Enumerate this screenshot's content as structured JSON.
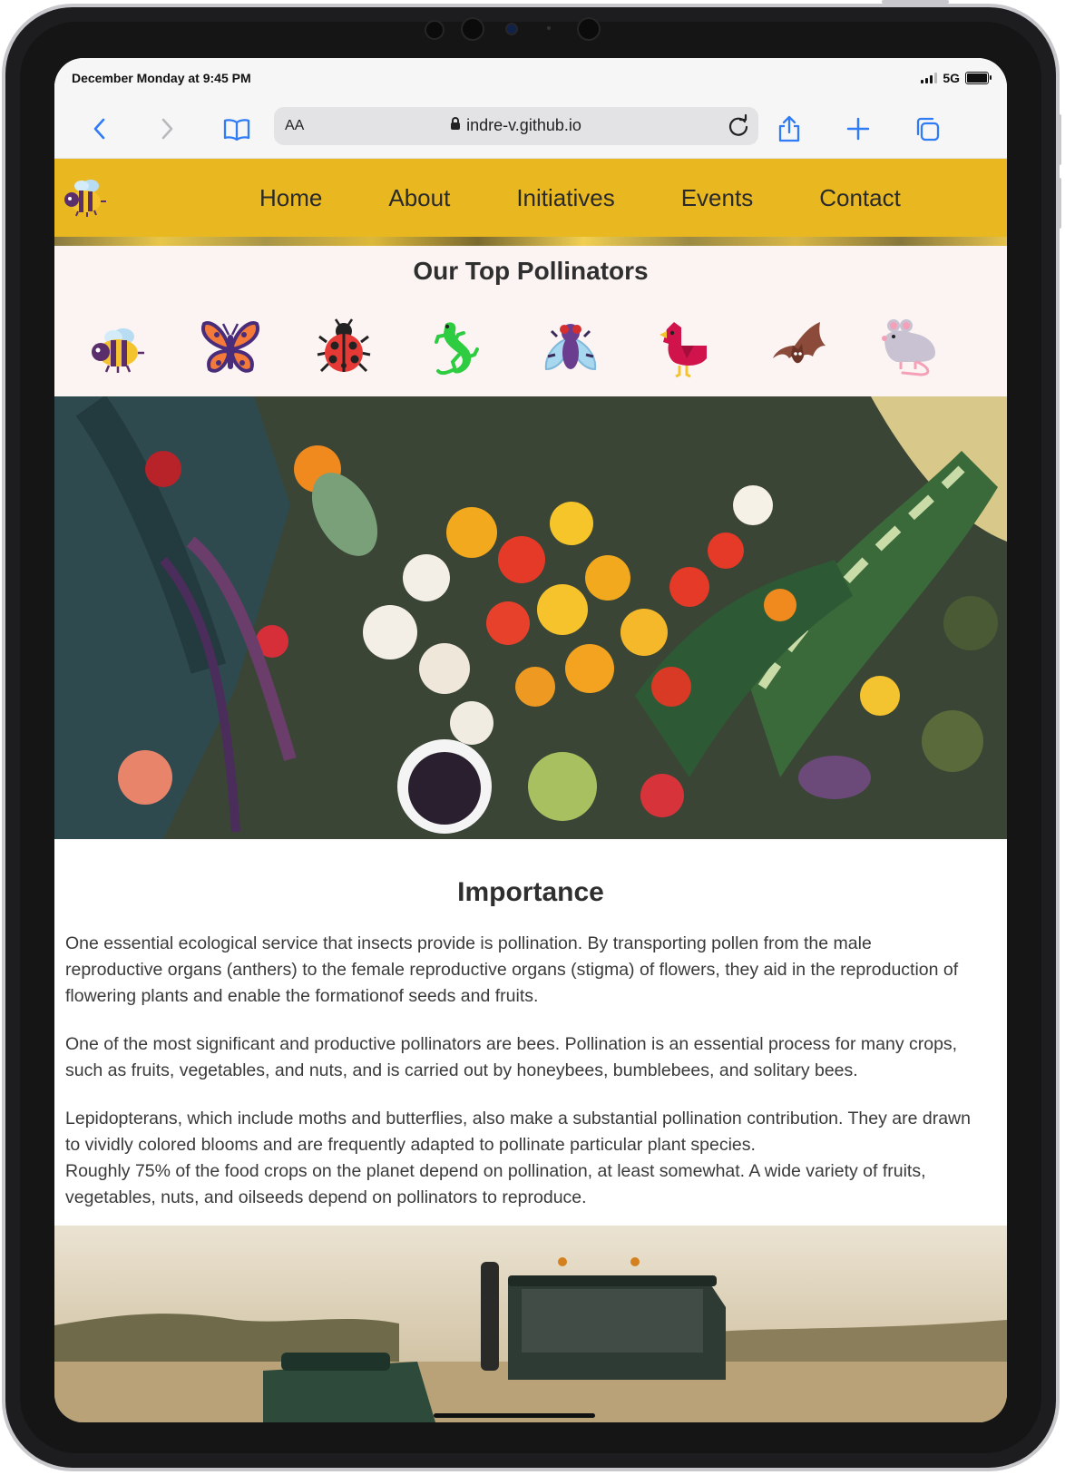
{
  "status_bar": {
    "time": "December Monday at 9:45 PM",
    "network": "5G"
  },
  "browser": {
    "aa_label": "AA",
    "host": "indre-v.github.io"
  },
  "nav": {
    "items": [
      {
        "label": "Home"
      },
      {
        "label": "About"
      },
      {
        "label": "Initiatives"
      },
      {
        "label": "Events"
      },
      {
        "label": "Contact"
      }
    ]
  },
  "pollinators": {
    "title": "Our Top Pollinators",
    "icons": [
      "bee-icon",
      "butterfly-icon",
      "ladybug-icon",
      "lizard-icon",
      "fly-icon",
      "bird-icon",
      "bat-icon",
      "mouse-icon"
    ]
  },
  "importance": {
    "title": "Importance",
    "p1": "One essential ecological service that insects provide is pollination. By transporting pollen from the male reproductive organs (anthers) to the female reproductive organs (stigma) of flowers, they aid in the reproduction of flowering plants and enable the formationof seeds and fruits.",
    "p2": "One of the most significant and productive pollinators are bees. Pollination is an essential process for many crops, such as fruits, vegetables, and nuts, and is carried out by honeybees, bumblebees, and solitary bees.",
    "p3": "Lepidopterans, which include moths and butterflies, also make a substantial pollination contribution. They are drawn to vividly colored blooms and are frequently adapted to pollinate particular plant species.",
    "p4": "Roughly 75% of the food crops on the planet depend on pollination, at least somewhat. A wide variety of fruits, vegetables, nuts, and oilseeds depend on pollinators to reproduce."
  },
  "colors": {
    "navbar": "#e9b820",
    "pollinator_bg": "#fcf4f2",
    "text": "#3a3a3a",
    "accent_blue": "#2f7cf6"
  }
}
